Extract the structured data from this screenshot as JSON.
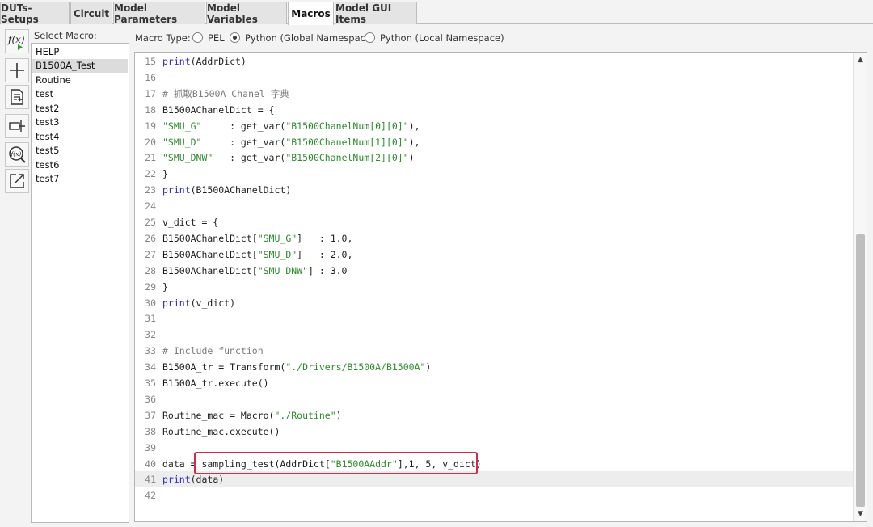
{
  "tabs": [
    {
      "label": "DUTs-Setups",
      "active": false
    },
    {
      "label": "Circuit",
      "active": false
    },
    {
      "label": "Model Parameters",
      "active": false
    },
    {
      "label": "Model Variables",
      "active": false
    },
    {
      "label": "Macros",
      "active": true
    },
    {
      "label": "Model GUI Items",
      "active": false
    }
  ],
  "toolbar": {
    "icons": [
      "function-run-icon",
      "add-icon",
      "document-import-icon",
      "resize-icon",
      "function-search-icon",
      "export-icon"
    ]
  },
  "macro_list": {
    "label": "Select Macro:",
    "items": [
      "HELP",
      "B1500A_Test",
      "Routine",
      "test",
      "test2",
      "test3",
      "test4",
      "test5",
      "test6",
      "test7"
    ],
    "selected": "B1500A_Test"
  },
  "macro_type": {
    "label": "Macro Type:",
    "options": [
      "PEL",
      "Python (Global Namespace)",
      "Python (Local Namespace)"
    ],
    "selected": "Python (Global Namespace)"
  },
  "editor": {
    "current_line": 41,
    "highlighted_line": 40,
    "scroll_fraction": 0.38,
    "lines": [
      {
        "n": "15",
        "tokens": [
          {
            "t": "print",
            "c": "kw"
          },
          {
            "t": "(AddrDict)",
            "c": ""
          }
        ]
      },
      {
        "n": "16",
        "tokens": []
      },
      {
        "n": "17",
        "tokens": [
          {
            "t": "# 抓取B1500A Chanel 字典",
            "c": "cm"
          }
        ]
      },
      {
        "n": "18",
        "tokens": [
          {
            "t": "B1500AChanelDict = {",
            "c": ""
          }
        ]
      },
      {
        "n": "19",
        "tokens": [
          {
            "t": "\"SMU_G\"",
            "c": "str"
          },
          {
            "t": "     : get_var(",
            "c": ""
          },
          {
            "t": "\"B1500ChanelNum[0][0]\"",
            "c": "str"
          },
          {
            "t": "),",
            "c": ""
          }
        ]
      },
      {
        "n": "20",
        "tokens": [
          {
            "t": "\"SMU_D\"",
            "c": "str"
          },
          {
            "t": "     : get_var(",
            "c": ""
          },
          {
            "t": "\"B1500ChanelNum[1][0]\"",
            "c": "str"
          },
          {
            "t": "),",
            "c": ""
          }
        ]
      },
      {
        "n": "21",
        "tokens": [
          {
            "t": "\"SMU_DNW\"",
            "c": "str"
          },
          {
            "t": "   : get_var(",
            "c": ""
          },
          {
            "t": "\"B1500ChanelNum[2][0]\"",
            "c": "str"
          },
          {
            "t": ")",
            "c": ""
          }
        ]
      },
      {
        "n": "22",
        "tokens": [
          {
            "t": "}",
            "c": ""
          }
        ]
      },
      {
        "n": "23",
        "tokens": [
          {
            "t": "print",
            "c": "kw"
          },
          {
            "t": "(B1500AChanelDict)",
            "c": ""
          }
        ]
      },
      {
        "n": "24",
        "tokens": []
      },
      {
        "n": "25",
        "tokens": [
          {
            "t": "v_dict = {",
            "c": ""
          }
        ]
      },
      {
        "n": "26",
        "tokens": [
          {
            "t": "B1500AChanelDict[",
            "c": ""
          },
          {
            "t": "\"SMU_G\"",
            "c": "str"
          },
          {
            "t": "]   : 1.0,",
            "c": ""
          }
        ]
      },
      {
        "n": "27",
        "tokens": [
          {
            "t": "B1500AChanelDict[",
            "c": ""
          },
          {
            "t": "\"SMU_D\"",
            "c": "str"
          },
          {
            "t": "]   : 2.0,",
            "c": ""
          }
        ]
      },
      {
        "n": "28",
        "tokens": [
          {
            "t": "B1500AChanelDict[",
            "c": ""
          },
          {
            "t": "\"SMU_DNW\"",
            "c": "str"
          },
          {
            "t": "] : 3.0",
            "c": ""
          }
        ]
      },
      {
        "n": "29",
        "tokens": [
          {
            "t": "}",
            "c": ""
          }
        ]
      },
      {
        "n": "30",
        "tokens": [
          {
            "t": "print",
            "c": "kw"
          },
          {
            "t": "(v_dict)",
            "c": ""
          }
        ]
      },
      {
        "n": "31",
        "tokens": []
      },
      {
        "n": "32",
        "tokens": []
      },
      {
        "n": "33",
        "tokens": [
          {
            "t": "# Include function",
            "c": "cm"
          }
        ]
      },
      {
        "n": "34",
        "tokens": [
          {
            "t": "B1500A_tr = Transform(",
            "c": ""
          },
          {
            "t": "\"./Drivers/B1500A/B1500A\"",
            "c": "str"
          },
          {
            "t": ")",
            "c": ""
          }
        ]
      },
      {
        "n": "35",
        "tokens": [
          {
            "t": "B1500A_tr.execute()",
            "c": ""
          }
        ]
      },
      {
        "n": "36",
        "tokens": []
      },
      {
        "n": "37",
        "tokens": [
          {
            "t": "Routine_mac = Macro(",
            "c": ""
          },
          {
            "t": "\"./Routine\"",
            "c": "str"
          },
          {
            "t": ")",
            "c": ""
          }
        ]
      },
      {
        "n": "38",
        "tokens": [
          {
            "t": "Routine_mac.execute()",
            "c": ""
          }
        ]
      },
      {
        "n": "39",
        "tokens": []
      },
      {
        "n": "40",
        "tokens": [
          {
            "t": "data = sampling_test(AddrDict[",
            "c": ""
          },
          {
            "t": "\"B1500AAddr\"",
            "c": "str"
          },
          {
            "t": "],1, 5, v_dict)",
            "c": ""
          }
        ]
      },
      {
        "n": "41",
        "tokens": [
          {
            "t": "print",
            "c": "kw"
          },
          {
            "t": "(data)",
            "c": ""
          }
        ]
      },
      {
        "n": "42",
        "tokens": []
      }
    ]
  }
}
